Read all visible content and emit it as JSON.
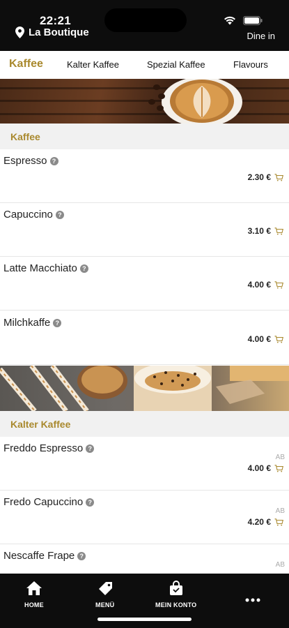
{
  "status_bar": {
    "time": "22:21",
    "icons": [
      "signal-icon",
      "wifi-icon",
      "battery-icon"
    ]
  },
  "header": {
    "location_name": "La Boutique",
    "mode": "Dine in"
  },
  "tabs": [
    {
      "label": "Kaffee",
      "active": true
    },
    {
      "label": "Kalter Kaffee",
      "active": false
    },
    {
      "label": "Spezial Kaffee",
      "active": false
    },
    {
      "label": "Flavours",
      "active": false
    }
  ],
  "sections": [
    {
      "title": "Kaffee",
      "items": [
        {
          "name": "Espresso",
          "price": "2.30 €"
        },
        {
          "name": "Capuccino",
          "price": "3.10 €"
        },
        {
          "name": "Latte Macchiato",
          "price": "4.00 €"
        },
        {
          "name": "Milchkaffe",
          "price": "4.00 €"
        }
      ]
    },
    {
      "title": "Kalter Kaffee",
      "items": [
        {
          "name": "Freddo Espresso",
          "price": "4.00 €",
          "prefix": "AB"
        },
        {
          "name": "Fredo Capuccino",
          "price": "4.20 €",
          "prefix": "AB"
        },
        {
          "name": "Nescaffe Frape",
          "price": "",
          "prefix": "AB"
        }
      ]
    }
  ],
  "bottom_nav": [
    {
      "label": "HOME",
      "icon": "home-icon"
    },
    {
      "label": "MENÜ",
      "icon": "tag-icon"
    },
    {
      "label": "MEIN KONTO",
      "icon": "bag-icon"
    },
    {
      "label": "",
      "icon": "more-icon"
    }
  ],
  "colors": {
    "accent": "#a9892e",
    "header_bg": "#0d0d0d",
    "section_bg": "#f1f1f1"
  }
}
